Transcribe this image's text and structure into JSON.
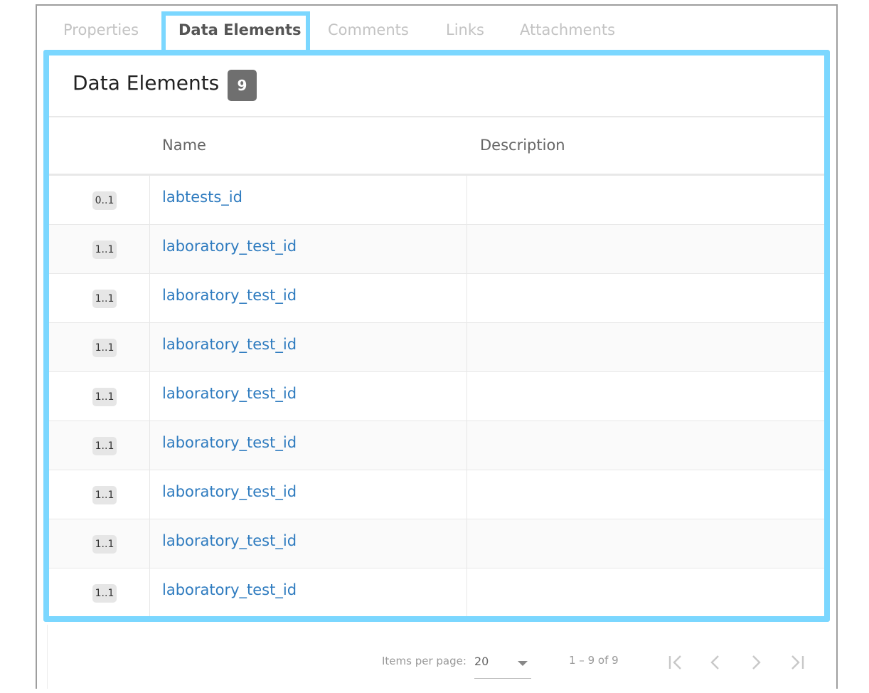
{
  "tabs": [
    {
      "label": "Properties"
    },
    {
      "label": "Data Elements"
    },
    {
      "label": "Comments"
    },
    {
      "label": "Links"
    },
    {
      "label": "Attachments"
    }
  ],
  "panel": {
    "title": "Data Elements",
    "count": "9"
  },
  "table": {
    "columns": [
      "Name",
      "Description"
    ],
    "rows": [
      {
        "multiplicity": "0..1",
        "name": "labtests_id",
        "description": ""
      },
      {
        "multiplicity": "1..1",
        "name": "laboratory_test_id",
        "description": ""
      },
      {
        "multiplicity": "1..1",
        "name": "laboratory_test_id",
        "description": ""
      },
      {
        "multiplicity": "1..1",
        "name": "laboratory_test_id",
        "description": ""
      },
      {
        "multiplicity": "1..1",
        "name": "laboratory_test_id",
        "description": ""
      },
      {
        "multiplicity": "1..1",
        "name": "laboratory_test_id",
        "description": ""
      },
      {
        "multiplicity": "1..1",
        "name": "laboratory_test_id",
        "description": ""
      },
      {
        "multiplicity": "1..1",
        "name": "laboratory_test_id",
        "description": ""
      },
      {
        "multiplicity": "1..1",
        "name": "laboratory_test_id",
        "description": ""
      }
    ]
  },
  "paginator": {
    "items_per_page_label": "Items per page:",
    "items_per_page_value": "20",
    "range_label": "1 – 9 of 9",
    "icons": [
      "first-page-icon",
      "previous-page-icon",
      "next-page-icon",
      "last-page-icon"
    ]
  },
  "colors": {
    "highlight": "#7bd7ff",
    "link": "#2e7bbf",
    "badge": "#6f6f6f"
  }
}
